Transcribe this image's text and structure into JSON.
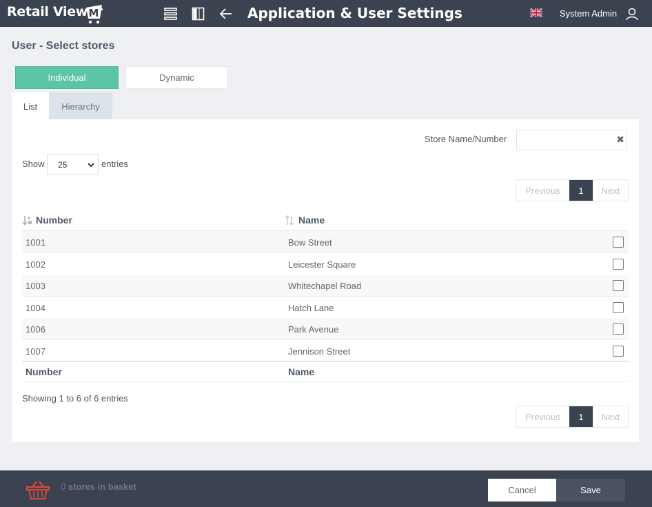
{
  "header": {
    "logo_text": "Retail Viewer",
    "logo_mark": "M",
    "title": "Application & User Settings",
    "user_name": "System Admin",
    "icons": [
      "list-menu-icon",
      "sidebar-panel-icon",
      "back-arrow-icon",
      "uk-flag-icon",
      "user-icon"
    ]
  },
  "page": {
    "title": "User - Select stores"
  },
  "mode_buttons": {
    "individual": "Individual",
    "dynamic": "Dynamic",
    "active": "individual"
  },
  "tabs": {
    "list": "List",
    "hierarchy": "Hierarchy",
    "active": "list"
  },
  "search": {
    "label": "Store Name/Number",
    "value": "",
    "placeholder": "",
    "clear_symbol": "✖"
  },
  "length": {
    "show_label": "Show",
    "selected": "25",
    "entries_label": "entries"
  },
  "pager": {
    "previous": "Previous",
    "current": "1",
    "next": "Next"
  },
  "table": {
    "columns": [
      "Number",
      "Name"
    ],
    "rows": [
      {
        "number": "1001",
        "name": "Bow Street",
        "checked": false
      },
      {
        "number": "1002",
        "name": "Leicester Square",
        "checked": false
      },
      {
        "number": "1003",
        "name": "Whitechapel Road",
        "checked": false
      },
      {
        "number": "1004",
        "name": "Hatch Lane",
        "checked": false
      },
      {
        "number": "1006",
        "name": "Park Avenue",
        "checked": false
      },
      {
        "number": "1007",
        "name": "Jennison Street",
        "checked": false
      }
    ],
    "footer_columns": [
      "Number",
      "Name"
    ],
    "info": "Showing 1 to 6 of 6 entries"
  },
  "footer": {
    "basket_count": "0",
    "basket_text": "stores in basket",
    "cancel": "Cancel",
    "save": "Save"
  },
  "colors": {
    "header_bg": "#3b4350",
    "accent": "#5cc5a8",
    "basket_icon": "#e0473a"
  }
}
